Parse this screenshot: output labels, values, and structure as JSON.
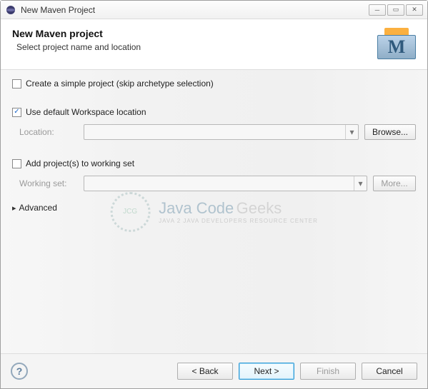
{
  "window": {
    "title": "New Maven Project"
  },
  "header": {
    "title": "New Maven project",
    "subtitle": "Select project name and location",
    "iconLetter": "M"
  },
  "options": {
    "simpleProject": {
      "label": "Create a simple project (skip archetype selection)",
      "checked": false
    },
    "defaultWorkspace": {
      "label": "Use default Workspace location",
      "checked": true
    },
    "location": {
      "label": "Location:",
      "value": "",
      "browseLabel": "Browse...",
      "enabled": false
    },
    "addToWorkingSet": {
      "label": "Add project(s) to working set",
      "checked": false
    },
    "workingSet": {
      "label": "Working set:",
      "value": "",
      "moreLabel": "More...",
      "enabled": false
    },
    "advancedLabel": "Advanced"
  },
  "watermark": {
    "circle": "JCG",
    "text1": "Java Code",
    "text2": "Geeks",
    "subtitle": "JAVA 2 JAVA DEVELOPERS RESOURCE CENTER"
  },
  "footer": {
    "back": "< Back",
    "next": "Next >",
    "finish": "Finish",
    "cancel": "Cancel"
  }
}
